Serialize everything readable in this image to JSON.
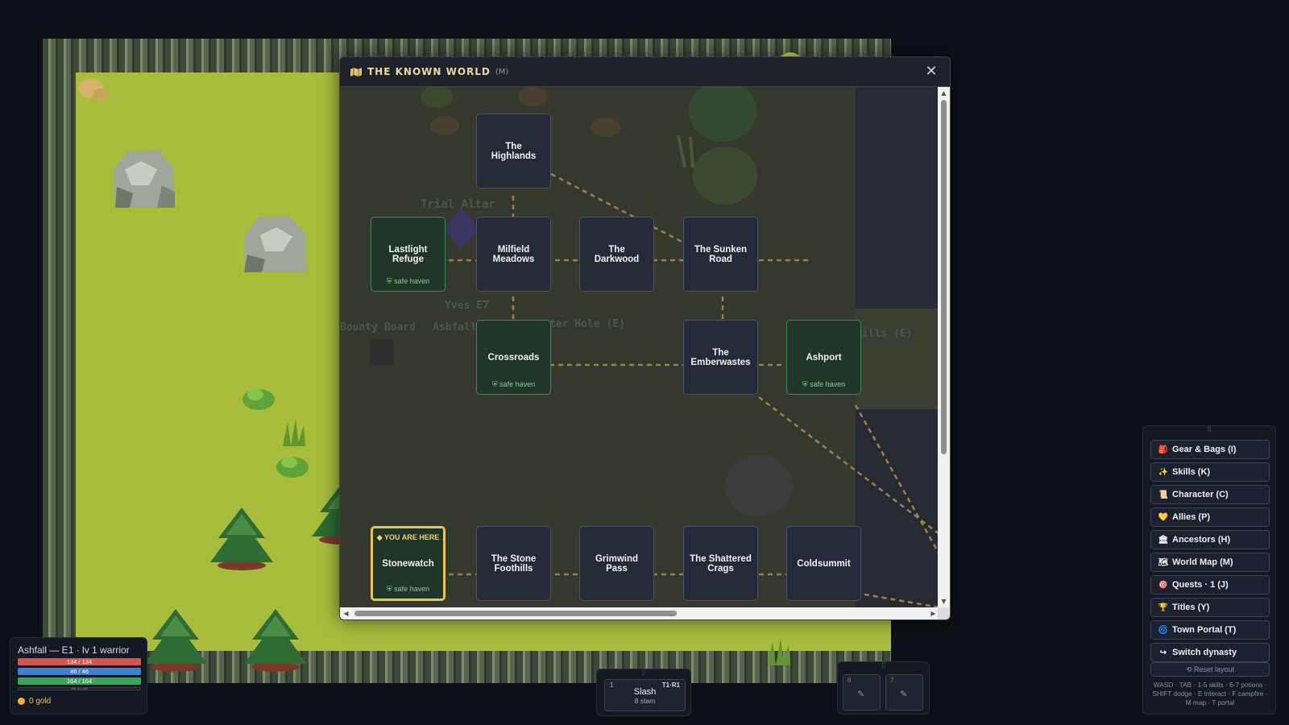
{
  "world_map": {
    "title": "THE KNOWN WORLD",
    "hotkey": "(M)",
    "close_icon": "✕",
    "background_labels": {
      "trial_altar": "Trial Altar",
      "yves": "Yves E7",
      "bounty_board": "Bounty Board",
      "ashfall": "Ashfall",
      "water_hole": "ter Hole (E)",
      "hills": "hills (E)"
    },
    "you_are_here": "◆ YOU ARE HERE",
    "safe_haven_label": "⛨ safe haven",
    "nodes": [
      {
        "name": "The Highlands",
        "safe": false
      },
      {
        "name": "Lastlight Refuge",
        "safe": true
      },
      {
        "name": "Milfield Meadows",
        "safe": false
      },
      {
        "name": "The Darkwood",
        "safe": false
      },
      {
        "name": "The Sunken Road",
        "safe": false
      },
      {
        "name": "Crossroads",
        "safe": true
      },
      {
        "name": "The Emberwastes",
        "safe": false
      },
      {
        "name": "Ashport",
        "safe": true
      },
      {
        "name": "Stonewatch",
        "safe": true,
        "current": true
      },
      {
        "name": "The Stone Foothills",
        "safe": false
      },
      {
        "name": "Grimwind Pass",
        "safe": false
      },
      {
        "name": "The Shattered Crags",
        "safe": false
      },
      {
        "name": "Coldsummit",
        "safe": false
      }
    ]
  },
  "player": {
    "title": "Ashfall — E1 · lv 1 warrior",
    "hp": {
      "text": "134 / 134",
      "fraction": 1.0,
      "color": "#d9534f"
    },
    "mp": {
      "text": "46 / 46",
      "fraction": 1.0,
      "color": "#3f7fd6"
    },
    "stamina": {
      "text": "164 / 164",
      "fraction": 1.0,
      "color": "#3fa45c"
    },
    "xp": {
      "text": "XP 0 / 20",
      "fraction": 0.0
    },
    "gold": "0 gold"
  },
  "skillbar": {
    "grip": "⠿",
    "key": "1",
    "rank": "T1·R1",
    "name": "Slash",
    "cost": "8 stam"
  },
  "potions": {
    "grip": "⠿",
    "slots": [
      {
        "key": "6",
        "icon": "✎"
      },
      {
        "key": "7",
        "icon": "✎"
      }
    ]
  },
  "menu": {
    "grip": "⠿",
    "items": [
      {
        "icon": "🎒",
        "label": "Gear & Bags (I)"
      },
      {
        "icon": "✨",
        "label": "Skills (K)"
      },
      {
        "icon": "📜",
        "label": "Character (C)"
      },
      {
        "icon": "💛",
        "label": "Allies (P)"
      },
      {
        "icon": "🏛",
        "label": "Ancestors (H)"
      },
      {
        "icon": "🗺",
        "label": "World Map (M)"
      },
      {
        "icon": "🎯",
        "label": "Quests · 1 (J)"
      },
      {
        "icon": "🏆",
        "label": "Titles (Y)"
      },
      {
        "icon": "🌀",
        "label": "Town Portal (T)"
      },
      {
        "icon": "↪",
        "label": "Switch dynasty"
      }
    ],
    "reset": "⟲ Reset layout",
    "help": "WASD · TAB · 1-5 skills · 6-7 potions · SHIFT dodge · E interact · F campfire · M map · T portal"
  },
  "colors": {
    "grass": "#a9bd3d",
    "safe_border": "#3f8a55",
    "current_border": "#e8c25a",
    "route": "#a0804a"
  }
}
